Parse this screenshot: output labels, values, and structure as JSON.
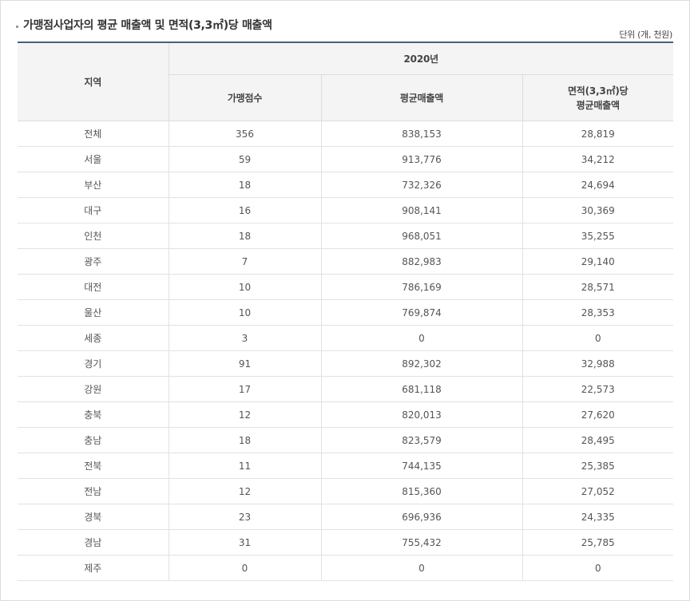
{
  "title": "가맹점사업자의 평균 매출액 및 면적(3,3㎡)당 매출액",
  "unit": "단위 (개, 천원)",
  "table": {
    "header_region": "지역",
    "header_year": "2020년",
    "header_stores": "가맹점수",
    "header_avg_sales": "평균매출액",
    "header_area_sales_line1": "면적(3,3㎡)당",
    "header_area_sales_line2": "평균매출액",
    "rows": [
      {
        "region": "전체",
        "stores": "356",
        "avg_sales": "838,153",
        "area_sales": "28,819"
      },
      {
        "region": "서울",
        "stores": "59",
        "avg_sales": "913,776",
        "area_sales": "34,212"
      },
      {
        "region": "부산",
        "stores": "18",
        "avg_sales": "732,326",
        "area_sales": "24,694"
      },
      {
        "region": "대구",
        "stores": "16",
        "avg_sales": "908,141",
        "area_sales": "30,369"
      },
      {
        "region": "인천",
        "stores": "18",
        "avg_sales": "968,051",
        "area_sales": "35,255"
      },
      {
        "region": "광주",
        "stores": "7",
        "avg_sales": "882,983",
        "area_sales": "29,140"
      },
      {
        "region": "대전",
        "stores": "10",
        "avg_sales": "786,169",
        "area_sales": "28,571"
      },
      {
        "region": "울산",
        "stores": "10",
        "avg_sales": "769,874",
        "area_sales": "28,353"
      },
      {
        "region": "세종",
        "stores": "3",
        "avg_sales": "0",
        "area_sales": "0"
      },
      {
        "region": "경기",
        "stores": "91",
        "avg_sales": "892,302",
        "area_sales": "32,988"
      },
      {
        "region": "강원",
        "stores": "17",
        "avg_sales": "681,118",
        "area_sales": "22,573"
      },
      {
        "region": "충북",
        "stores": "12",
        "avg_sales": "820,013",
        "area_sales": "27,620"
      },
      {
        "region": "충남",
        "stores": "18",
        "avg_sales": "823,579",
        "area_sales": "28,495"
      },
      {
        "region": "전북",
        "stores": "11",
        "avg_sales": "744,135",
        "area_sales": "25,385"
      },
      {
        "region": "전남",
        "stores": "12",
        "avg_sales": "815,360",
        "area_sales": "27,052"
      },
      {
        "region": "경북",
        "stores": "23",
        "avg_sales": "696,936",
        "area_sales": "24,335"
      },
      {
        "region": "경남",
        "stores": "31",
        "avg_sales": "755,432",
        "area_sales": "25,785"
      },
      {
        "region": "제주",
        "stores": "0",
        "avg_sales": "0",
        "area_sales": "0"
      }
    ]
  },
  "colors": {
    "header_bg": "#f4f4f4",
    "header_top_border": "#4a5f7a",
    "grid": "#e2e2e2",
    "text": "#555555"
  }
}
